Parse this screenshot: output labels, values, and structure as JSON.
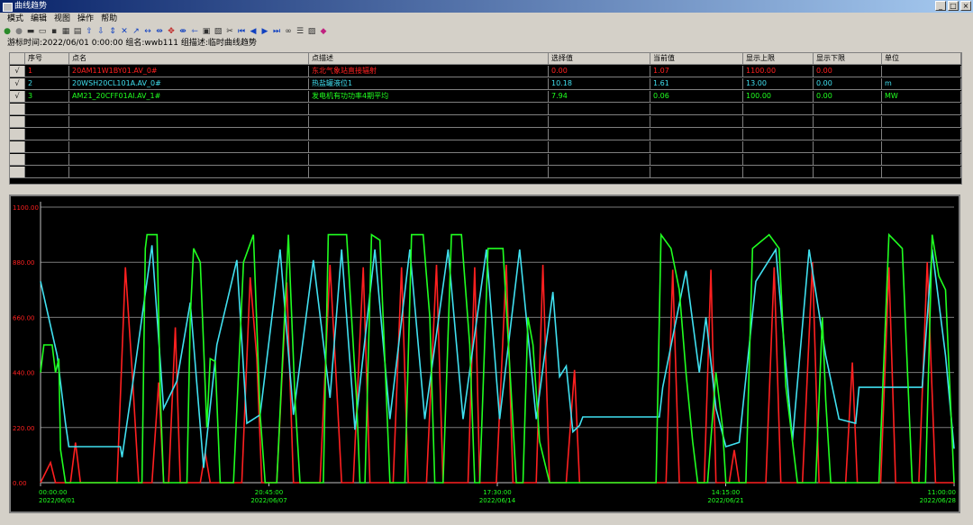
{
  "window": {
    "title": "曲线趋势"
  },
  "window_buttons": {
    "minimize": "_",
    "maximize": "□",
    "close": "×"
  },
  "menu": [
    "模式",
    "编辑",
    "视图",
    "操作",
    "帮助"
  ],
  "toolbar_icons": [
    "record-icon",
    "stop-icon",
    "print-icon",
    "open-icon",
    "save-icon",
    "table-icon",
    "chart-icon",
    "zoom-up-icon",
    "zoom-down-icon",
    "fit-vertical-icon",
    "center-icon",
    "zoom-in-icon",
    "zoom-out-icon",
    "fit-horizontal-icon",
    "pan-icon",
    "expand-icon",
    "shrink-icon",
    "mark-icon",
    "copy-icon",
    "tools-icon",
    "first-icon",
    "prev-icon",
    "next-icon",
    "last-icon",
    "binoculars-icon",
    "settings-icon",
    "export-icon",
    "clear-icon"
  ],
  "status": {
    "line": "游标时间:2022/06/01 0:00:00  组名:wwb111  组描述:临时曲线趋势"
  },
  "table": {
    "headers": [
      "序号",
      "点名",
      "点描述",
      "选择值",
      "当前值",
      "显示上限",
      "显示下限",
      "单位"
    ],
    "rows": [
      {
        "check": "√",
        "no": "1",
        "name": "20AM11W1BY01.AV_0#",
        "desc": "东北气象站直接辐射",
        "sel": "0.00",
        "cur": "1.07",
        "max": "1100.00",
        "min": "0.00",
        "unit": "",
        "color": "#ff2020"
      },
      {
        "check": "√",
        "no": "2",
        "name": "20WSH20CL101A.AV_0#",
        "desc": "热盐罐液位1",
        "sel": "10.18",
        "cur": "1.61",
        "max": "13.00",
        "min": "0.00",
        "unit": "m",
        "color": "#40e0f0"
      },
      {
        "check": "√",
        "no": "3",
        "name": "AM21_20CFF01AI.AV_1#",
        "desc": "发电机有功功率4期平均",
        "sel": "7.94",
        "cur": "0.06",
        "max": "100.00",
        "min": "0.00",
        "unit": "MW",
        "color": "#20ff20"
      }
    ],
    "empty_rows": 6
  },
  "chart_data": {
    "type": "line",
    "y_ticks": [
      "1100.00",
      "880.00",
      "660.00",
      "440.00",
      "220.00",
      "0.00"
    ],
    "y_axis_color": "#ff2020",
    "x_ticks": [
      {
        "time": "00:00:00",
        "date": "2022/06/01"
      },
      {
        "time": "20:45:00",
        "date": "2022/06/07"
      },
      {
        "time": "17:30:00",
        "date": "2022/06/14"
      },
      {
        "time": "14:15:00",
        "date": "2022/06/21"
      },
      {
        "time": "11:00:00",
        "date": "2022/06/28"
      }
    ],
    "x_range_days": [
      0,
      27.458
    ],
    "grid": true,
    "series": [
      {
        "color": "#ff2020",
        "ylim": [
          0,
          1100
        ],
        "points": [
          [
            0,
            0
          ],
          [
            0.3,
            80
          ],
          [
            0.45,
            0
          ],
          [
            0.9,
            0
          ],
          [
            1.05,
            160
          ],
          [
            1.2,
            0
          ],
          [
            2.3,
            0
          ],
          [
            2.55,
            860
          ],
          [
            2.75,
            450
          ],
          [
            2.95,
            0
          ],
          [
            3.35,
            0
          ],
          [
            3.55,
            400
          ],
          [
            3.7,
            0
          ],
          [
            3.85,
            0
          ],
          [
            4.05,
            620
          ],
          [
            4.2,
            0
          ],
          [
            4.8,
            0
          ],
          [
            4.95,
            120
          ],
          [
            5.1,
            0
          ],
          [
            6.05,
            0
          ],
          [
            6.3,
            820
          ],
          [
            6.5,
            500
          ],
          [
            6.65,
            0
          ],
          [
            7.1,
            0
          ],
          [
            7.4,
            800
          ],
          [
            7.6,
            0
          ],
          [
            8.4,
            0
          ],
          [
            8.7,
            870
          ],
          [
            8.9,
            380
          ],
          [
            9.05,
            0
          ],
          [
            9.4,
            0
          ],
          [
            9.7,
            860
          ],
          [
            9.9,
            0
          ],
          [
            10.6,
            0
          ],
          [
            10.85,
            860
          ],
          [
            11.05,
            0
          ],
          [
            11.6,
            0
          ],
          [
            11.9,
            870
          ],
          [
            12.1,
            0
          ],
          [
            12.85,
            0
          ],
          [
            13.05,
            860
          ],
          [
            13.2,
            0
          ],
          [
            13.7,
            0
          ],
          [
            14.0,
            870
          ],
          [
            14.2,
            0
          ],
          [
            14.9,
            0
          ],
          [
            15.1,
            870
          ],
          [
            15.3,
            0
          ],
          [
            15.8,
            0
          ],
          [
            16.05,
            450
          ],
          [
            16.2,
            0
          ],
          [
            18.8,
            0
          ],
          [
            19.0,
            850
          ],
          [
            19.2,
            0
          ],
          [
            19.95,
            0
          ],
          [
            20.15,
            850
          ],
          [
            20.3,
            0
          ],
          [
            20.7,
            0
          ],
          [
            20.85,
            130
          ],
          [
            21.0,
            0
          ],
          [
            21.8,
            0
          ],
          [
            22.05,
            860
          ],
          [
            22.25,
            0
          ],
          [
            22.9,
            0
          ],
          [
            23.2,
            880
          ],
          [
            23.4,
            0
          ],
          [
            24.2,
            0
          ],
          [
            24.4,
            480
          ],
          [
            24.55,
            0
          ],
          [
            25.25,
            0
          ],
          [
            25.5,
            860
          ],
          [
            25.7,
            0
          ],
          [
            26.4,
            0
          ],
          [
            26.65,
            880
          ],
          [
            26.9,
            0
          ],
          [
            27.458,
            0
          ]
        ]
      },
      {
        "color": "#40e0f0",
        "ylim": [
          0,
          13
        ],
        "points": [
          [
            0,
            9.5
          ],
          [
            0.5,
            6
          ],
          [
            0.75,
            2.8
          ],
          [
            0.85,
            1.7
          ],
          [
            2.4,
            1.7
          ],
          [
            2.45,
            1.2
          ],
          [
            2.8,
            5
          ],
          [
            3.35,
            11.2
          ],
          [
            3.7,
            3.5
          ],
          [
            4.1,
            4.8
          ],
          [
            4.5,
            8.5
          ],
          [
            4.9,
            0.7
          ],
          [
            5.3,
            6.5
          ],
          [
            5.9,
            10.5
          ],
          [
            6.2,
            2.8
          ],
          [
            6.6,
            3.2
          ],
          [
            7.2,
            11
          ],
          [
            7.6,
            3.2
          ],
          [
            8.2,
            10.5
          ],
          [
            8.7,
            4
          ],
          [
            9.05,
            11
          ],
          [
            9.45,
            2.5
          ],
          [
            10.05,
            11
          ],
          [
            10.5,
            3
          ],
          [
            11.1,
            11
          ],
          [
            11.55,
            3
          ],
          [
            12.25,
            11
          ],
          [
            12.7,
            3
          ],
          [
            13.4,
            11
          ],
          [
            13.8,
            3
          ],
          [
            14.4,
            11
          ],
          [
            14.9,
            3
          ],
          [
            15.4,
            9
          ],
          [
            15.6,
            5
          ],
          [
            15.8,
            5.5
          ],
          [
            16,
            2.4
          ],
          [
            16.2,
            2.7
          ],
          [
            16.3,
            3.1
          ],
          [
            18.6,
            3.1
          ],
          [
            18.7,
            4.5
          ],
          [
            19.4,
            10
          ],
          [
            19.8,
            5.2
          ],
          [
            20.0,
            7.8
          ],
          [
            20.3,
            3.5
          ],
          [
            20.6,
            1.7
          ],
          [
            21.0,
            1.9
          ],
          [
            21.5,
            9.5
          ],
          [
            22.1,
            11
          ],
          [
            22.6,
            2
          ],
          [
            23.1,
            11
          ],
          [
            23.6,
            6
          ],
          [
            24.0,
            3
          ],
          [
            24.5,
            2.8
          ],
          [
            24.6,
            4.5
          ],
          [
            26.5,
            4.5
          ],
          [
            26.8,
            11
          ],
          [
            27.2,
            6
          ],
          [
            27.458,
            1.6
          ]
        ]
      },
      {
        "color": "#20ff20",
        "ylim": [
          0,
          100
        ],
        "points": [
          [
            0,
            40
          ],
          [
            0.1,
            50
          ],
          [
            0.35,
            50
          ],
          [
            0.45,
            40
          ],
          [
            0.55,
            45
          ],
          [
            0.6,
            12
          ],
          [
            0.75,
            0
          ],
          [
            3.05,
            0
          ],
          [
            3.15,
            85
          ],
          [
            3.2,
            90
          ],
          [
            3.5,
            90
          ],
          [
            3.6,
            32
          ],
          [
            3.7,
            0
          ],
          [
            4.4,
            0
          ],
          [
            4.5,
            60
          ],
          [
            4.6,
            85
          ],
          [
            4.8,
            80
          ],
          [
            5.0,
            20
          ],
          [
            5.1,
            45
          ],
          [
            5.25,
            44
          ],
          [
            5.4,
            0
          ],
          [
            5.8,
            0
          ],
          [
            6.1,
            80
          ],
          [
            6.4,
            90
          ],
          [
            6.6,
            25
          ],
          [
            6.75,
            0
          ],
          [
            7.1,
            0
          ],
          [
            7.45,
            90
          ],
          [
            7.65,
            30
          ],
          [
            7.8,
            0
          ],
          [
            8.5,
            0
          ],
          [
            8.65,
            90
          ],
          [
            9.2,
            90
          ],
          [
            9.5,
            30
          ],
          [
            9.6,
            0
          ],
          [
            9.75,
            0
          ],
          [
            9.95,
            90
          ],
          [
            10.2,
            88
          ],
          [
            10.5,
            0
          ],
          [
            10.95,
            0
          ],
          [
            11.15,
            90
          ],
          [
            11.5,
            90
          ],
          [
            11.7,
            60
          ],
          [
            11.85,
            0
          ],
          [
            12.1,
            0
          ],
          [
            12.35,
            90
          ],
          [
            12.65,
            90
          ],
          [
            12.9,
            50
          ],
          [
            13.05,
            0
          ],
          [
            13.2,
            0
          ],
          [
            13.45,
            85
          ],
          [
            13.9,
            85
          ],
          [
            14.3,
            0
          ],
          [
            14.5,
            0
          ],
          [
            14.65,
            60
          ],
          [
            14.8,
            50
          ],
          [
            15.0,
            15
          ],
          [
            15.3,
            0
          ],
          [
            18.5,
            0
          ],
          [
            18.65,
            90
          ],
          [
            18.95,
            85
          ],
          [
            19.2,
            70
          ],
          [
            19.4,
            40
          ],
          [
            19.6,
            15
          ],
          [
            19.75,
            0
          ],
          [
            20.05,
            0
          ],
          [
            20.3,
            40
          ],
          [
            20.5,
            20
          ],
          [
            20.6,
            0
          ],
          [
            21.2,
            0
          ],
          [
            21.4,
            85
          ],
          [
            21.9,
            90
          ],
          [
            22.2,
            85
          ],
          [
            22.4,
            35
          ],
          [
            22.6,
            15
          ],
          [
            22.75,
            0
          ],
          [
            23.3,
            0
          ],
          [
            23.5,
            60
          ],
          [
            23.6,
            30
          ],
          [
            23.75,
            0
          ],
          [
            25.2,
            0
          ],
          [
            25.5,
            90
          ],
          [
            25.9,
            85
          ],
          [
            26.2,
            0
          ],
          [
            26.6,
            0
          ],
          [
            26.8,
            90
          ],
          [
            27.0,
            75
          ],
          [
            27.2,
            70
          ],
          [
            27.458,
            0
          ]
        ]
      }
    ]
  }
}
